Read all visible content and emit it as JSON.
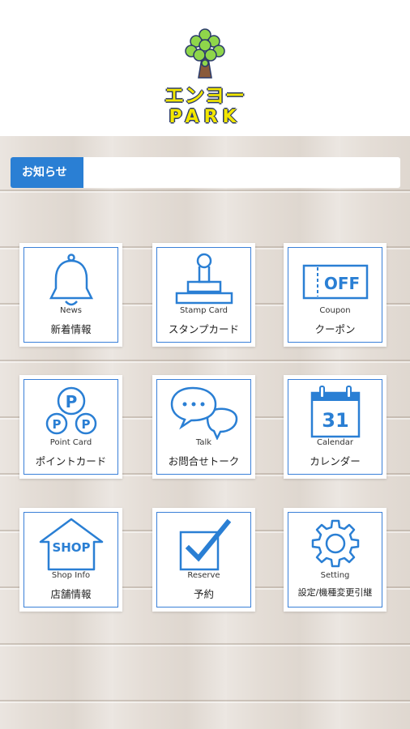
{
  "logo": {
    "line1": "エンヨー",
    "line2": "PARK",
    "colors": {
      "text": "#f2e600",
      "outline": "#2a3a6a",
      "leaf": "#8fd64a",
      "trunk": "#8a5a3a"
    }
  },
  "notice": {
    "label": "お知らせ",
    "value": ""
  },
  "accent_color": "#2a7fd4",
  "tiles": [
    {
      "icon": "bell-icon",
      "en": "News",
      "jp": "新着情報"
    },
    {
      "icon": "stamp-icon",
      "en": "Stamp Card",
      "jp": "スタンプカード"
    },
    {
      "icon": "coupon-icon",
      "en": "Coupon",
      "jp": "クーポン",
      "icon_text": "OFF"
    },
    {
      "icon": "point-card-icon",
      "en": "Point Card",
      "jp": "ポイントカード",
      "icon_text": "P"
    },
    {
      "icon": "chat-icon",
      "en": "Talk",
      "jp": "お問合せトーク"
    },
    {
      "icon": "calendar-icon",
      "en": "Calendar",
      "jp": "カレンダー",
      "icon_text": "31"
    },
    {
      "icon": "shop-icon",
      "en": "Shop Info",
      "jp": "店舗情報",
      "icon_text": "SHOP"
    },
    {
      "icon": "checkbox-icon",
      "en": "Reserve",
      "jp": "予約"
    },
    {
      "icon": "gear-icon",
      "en": "Setting",
      "jp": "設定/機種変更引継"
    }
  ]
}
